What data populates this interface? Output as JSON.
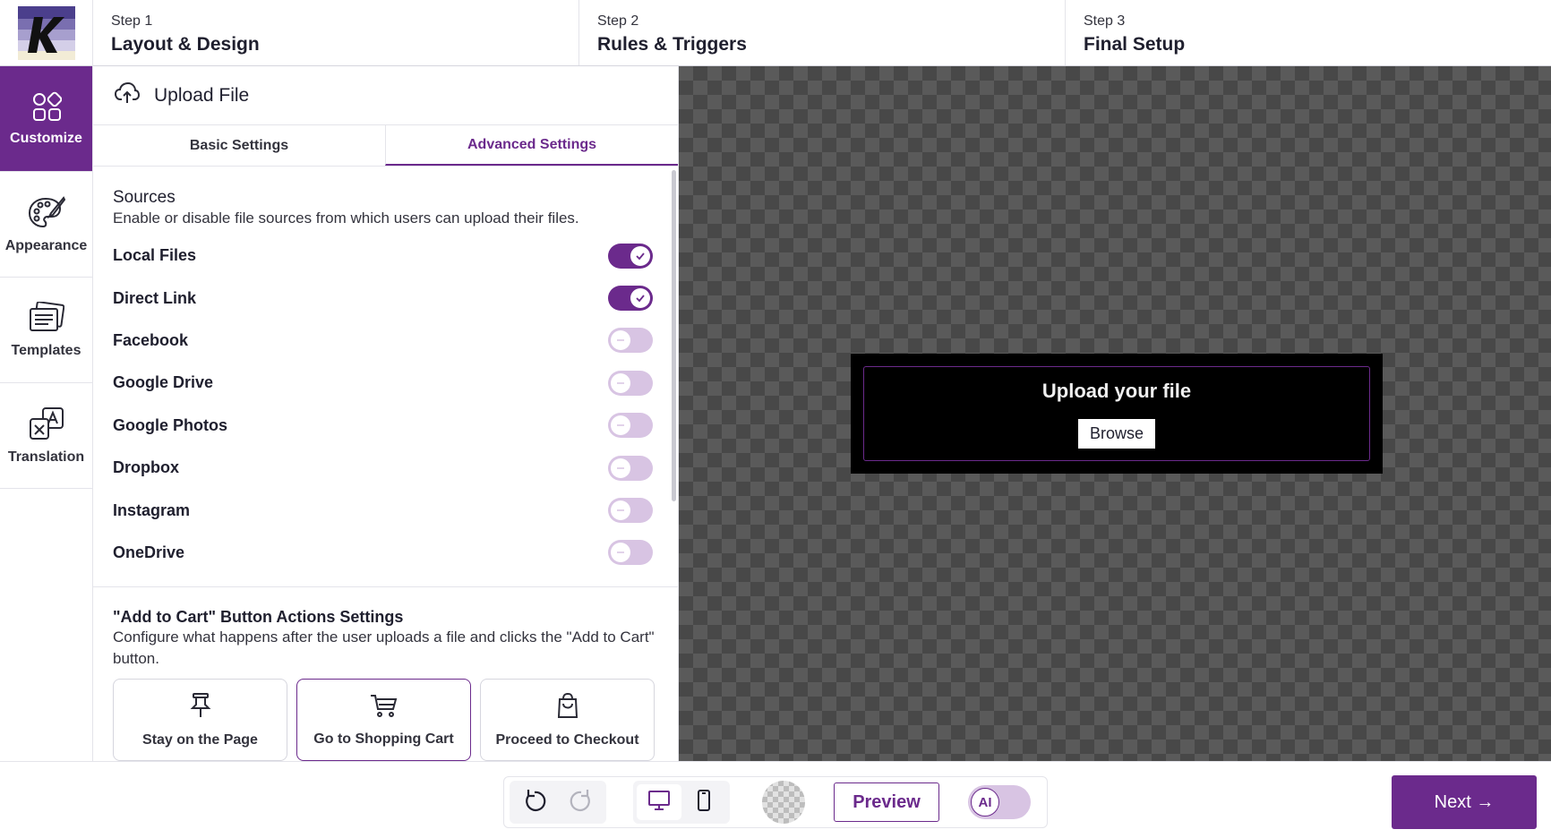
{
  "steps": [
    {
      "num": "Step 1",
      "title": "Layout & Design"
    },
    {
      "num": "Step 2",
      "title": "Rules & Triggers"
    },
    {
      "num": "Step 3",
      "title": "Final Setup"
    }
  ],
  "rail": [
    {
      "label": "Customize",
      "icon": "grid-shapes-icon",
      "active": true
    },
    {
      "label": "Appearance",
      "icon": "palette-icon",
      "active": false
    },
    {
      "label": "Templates",
      "icon": "templates-icon",
      "active": false
    },
    {
      "label": "Translation",
      "icon": "translate-icon",
      "active": false
    }
  ],
  "panel": {
    "title": "Upload File",
    "tabs": [
      {
        "label": "Basic Settings",
        "active": false
      },
      {
        "label": "Advanced Settings",
        "active": true
      }
    ],
    "sources": {
      "title": "Sources",
      "subtitle": "Enable or disable file sources from which users can upload their files.",
      "items": [
        {
          "label": "Local Files",
          "enabled": true
        },
        {
          "label": "Direct Link",
          "enabled": true
        },
        {
          "label": "Facebook",
          "enabled": false
        },
        {
          "label": "Google Drive",
          "enabled": false
        },
        {
          "label": "Google Photos",
          "enabled": false
        },
        {
          "label": "Dropbox",
          "enabled": false
        },
        {
          "label": "Instagram",
          "enabled": false
        },
        {
          "label": "OneDrive",
          "enabled": false
        }
      ]
    },
    "cart": {
      "title": "\"Add to Cart\" Button Actions Settings",
      "subtitle": "Configure what happens after the user uploads a file and clicks the \"Add to Cart\" button.",
      "options": [
        {
          "label": "Stay on the Page",
          "icon": "pin-icon",
          "selected": false
        },
        {
          "label": "Go to Shopping Cart",
          "icon": "cart-icon",
          "selected": true
        },
        {
          "label": "Proceed to Checkout",
          "icon": "bag-icon",
          "selected": false
        }
      ]
    }
  },
  "widget": {
    "title": "Upload your file",
    "button": "Browse"
  },
  "bottom": {
    "preview": "Preview",
    "ai": "AI",
    "ai_enabled": false,
    "next": "Next →",
    "view": "desktop"
  },
  "colors": {
    "accent": "#6b2a8c",
    "accent_light": "#d8c4e3"
  }
}
